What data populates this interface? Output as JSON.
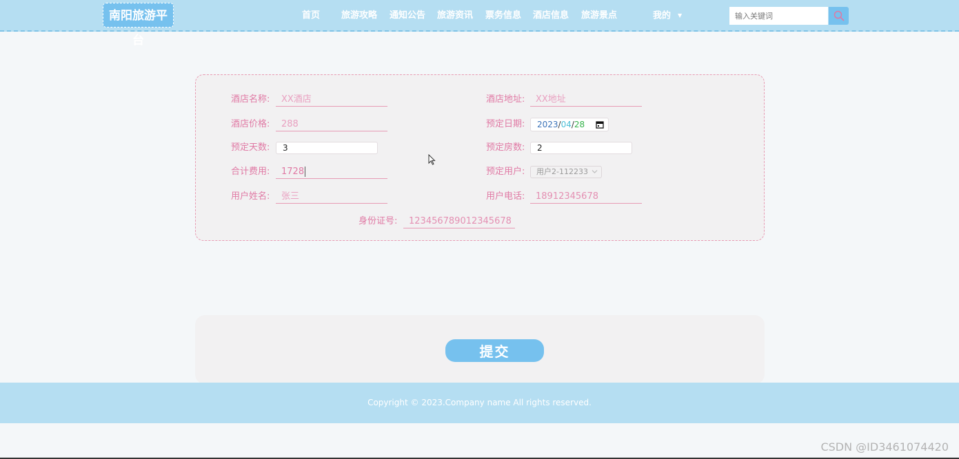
{
  "header": {
    "logo": "南阳旅游平台",
    "nav": [
      "首页",
      "旅游攻略",
      "通知公告",
      "旅游资讯",
      "票务信息",
      "酒店信息",
      "旅游景点"
    ],
    "account_menu": "我的",
    "search": {
      "placeholder": "输入关键词"
    }
  },
  "form": {
    "hotel_name": {
      "label": "酒店名称:",
      "value": "XX酒店"
    },
    "hotel_address": {
      "label": "酒店地址:",
      "value": "XX地址"
    },
    "hotel_price": {
      "label": "酒店价格:",
      "value": "288"
    },
    "booking_date": {
      "label": "预定日期:",
      "year": "2023",
      "month": "04",
      "day": "28"
    },
    "booking_days": {
      "label": "预定天数:",
      "value": "3"
    },
    "booking_rooms": {
      "label": "预定房数:",
      "value": "2"
    },
    "total_cost": {
      "label": "合计费用:",
      "value": "1728"
    },
    "booking_user": {
      "label": "预定用户:",
      "value": "用户2-112233"
    },
    "user_name": {
      "label": "用户姓名:",
      "value": "张三"
    },
    "user_phone": {
      "label": "用户电话:",
      "value": "18912345678"
    },
    "id_number": {
      "label": "身份证号:",
      "value": "123456789012345678"
    }
  },
  "submit_label": "提交",
  "footer": {
    "copyright": "Copyright © 2023.Company name All rights reserved."
  },
  "watermark": "CSDN @ID3461074420",
  "colors": {
    "header_bg": "#b5def2",
    "accent_blue": "#76c1ee",
    "label_pink": "#e079a4",
    "date_year": "#3a72b8",
    "date_month": "#4dbfd6",
    "date_day": "#35b34a"
  }
}
